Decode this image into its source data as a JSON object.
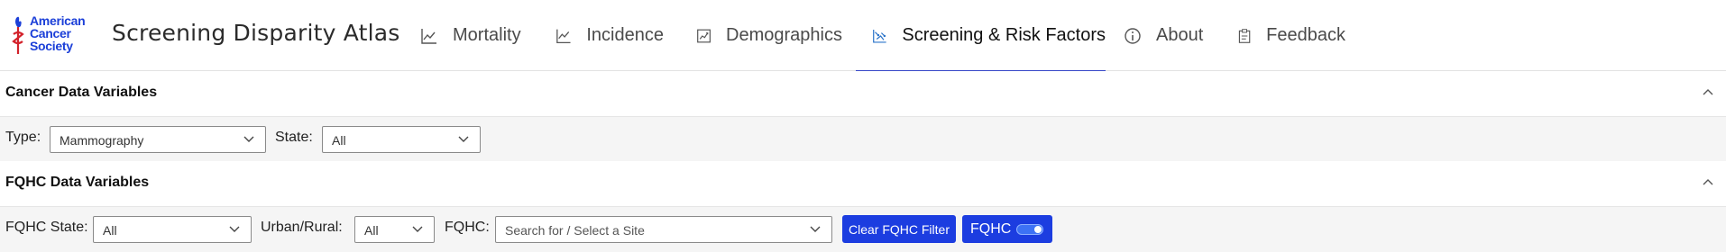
{
  "brand": {
    "logo_lines": [
      "American",
      "Cancer",
      "Society"
    ],
    "app_title": "Screening Disparity Atlas",
    "brand_color": "#1b3fd8",
    "torch_color": "#d3222b"
  },
  "nav": {
    "active_tab": "Screening & Risk Factors",
    "tabs": [
      {
        "label": "Mortality",
        "icon": "line-chart-icon"
      },
      {
        "label": "Incidence",
        "icon": "line-chart-icon"
      },
      {
        "label": "Demographics",
        "icon": "chart-box-icon"
      },
      {
        "label": "Screening & Risk Factors",
        "icon": "scatter-chart-icon"
      },
      {
        "label": "About",
        "icon": "info-icon"
      },
      {
        "label": "Feedback",
        "icon": "clipboard-icon"
      }
    ]
  },
  "cancer_section": {
    "title": "Cancer Data Variables",
    "collapse_icon": "chevron-up-icon",
    "type_label": "Type:",
    "type_value": "Mammography",
    "state_label": "State:",
    "state_value": "All"
  },
  "fqhc_section": {
    "title": "FQHC Data Variables",
    "collapse_icon": "chevron-up-icon",
    "fqhc_state_label": "FQHC State:",
    "fqhc_state_value": "All",
    "urban_rural_label": "Urban/Rural:",
    "urban_rural_value": "All",
    "fqhc_label": "FQHC:",
    "fqhc_placeholder": "Search for / Select a Site",
    "clear_button": "Clear FQHC Filter",
    "toggle_label": "FQHC",
    "toggle_on": true,
    "accent_color": "#1c3de0"
  }
}
